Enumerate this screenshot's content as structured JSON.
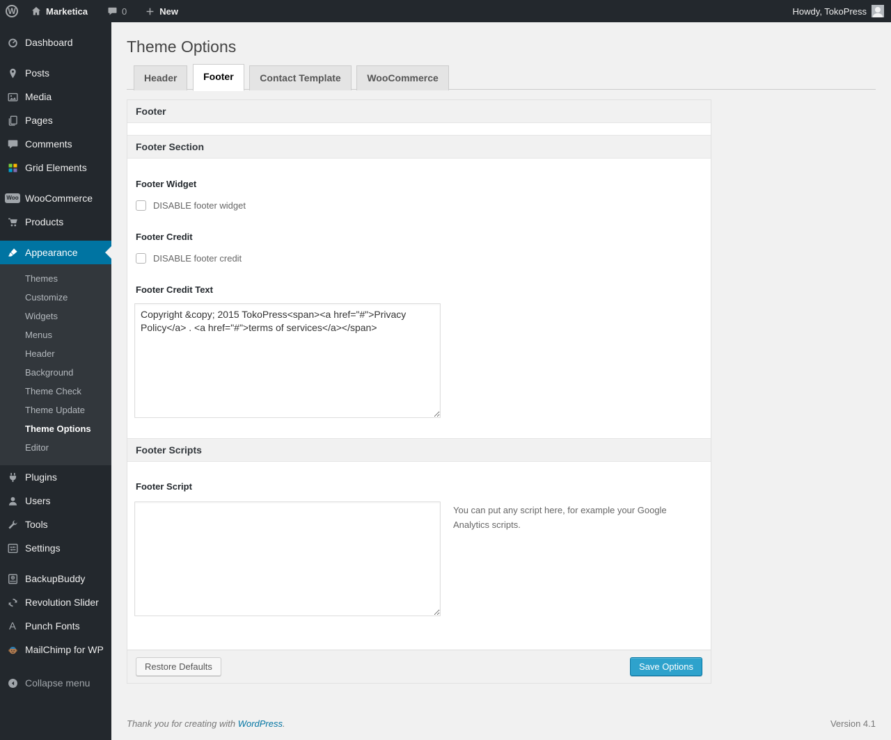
{
  "admin_bar": {
    "site_name": "Marketica",
    "comment_count": "0",
    "new_label": "New",
    "howdy": "Howdy, TokoPress"
  },
  "sidebar": {
    "items": [
      {
        "label": "Dashboard"
      },
      {
        "label": "Posts"
      },
      {
        "label": "Media"
      },
      {
        "label": "Pages"
      },
      {
        "label": "Comments"
      },
      {
        "label": "Grid Elements"
      },
      {
        "label": "WooCommerce"
      },
      {
        "label": "Products"
      },
      {
        "label": "Appearance",
        "active": true
      },
      {
        "label": "Plugins"
      },
      {
        "label": "Users"
      },
      {
        "label": "Tools"
      },
      {
        "label": "Settings"
      },
      {
        "label": "BackupBuddy"
      },
      {
        "label": "Revolution Slider"
      },
      {
        "label": "Punch Fonts"
      },
      {
        "label": "MailChimp for WP"
      },
      {
        "label": "Collapse menu"
      }
    ],
    "appearance_submenu": [
      {
        "label": "Themes"
      },
      {
        "label": "Customize"
      },
      {
        "label": "Widgets"
      },
      {
        "label": "Menus"
      },
      {
        "label": "Header"
      },
      {
        "label": "Background"
      },
      {
        "label": "Theme Check"
      },
      {
        "label": "Theme Update"
      },
      {
        "label": "Theme Options",
        "current": true
      },
      {
        "label": "Editor"
      }
    ]
  },
  "main": {
    "page_title": "Theme Options",
    "tabs": [
      {
        "label": "Header"
      },
      {
        "label": "Footer",
        "active": true
      },
      {
        "label": "Contact Template"
      },
      {
        "label": "WooCommerce"
      }
    ],
    "panel": {
      "group_title": "Footer",
      "section_title": "Footer Section",
      "footer_widget_label": "Footer Widget",
      "footer_widget_checkbox": "DISABLE footer widget",
      "footer_widget_checked": false,
      "footer_credit_label": "Footer Credit",
      "footer_credit_checkbox": "DISABLE footer credit",
      "footer_credit_checked": false,
      "footer_credit_text_label": "Footer Credit Text",
      "footer_credit_text_value": "Copyright &copy; 2015 TokoPress<span><a href=\"#\">Privacy Policy</a> . <a href=\"#\">terms of services</a></span>",
      "scripts_section_title": "Footer Scripts",
      "footer_script_label": "Footer Script",
      "footer_script_value": "",
      "footer_script_description": "You can put any script here, for example your Google Analytics scripts.",
      "restore_button": "Restore Defaults",
      "save_button": "Save Options"
    }
  },
  "page_footer": {
    "thanks_prefix": "Thank you for creating with ",
    "wordpress_link": "WordPress",
    "thanks_suffix": ".",
    "version": "Version 4.1"
  },
  "colors": {
    "accent_blue": "#0074a2",
    "primary_button_blue": "#2ea2cc",
    "admin_dark": "#23282d",
    "page_background": "#f1f1f1"
  }
}
